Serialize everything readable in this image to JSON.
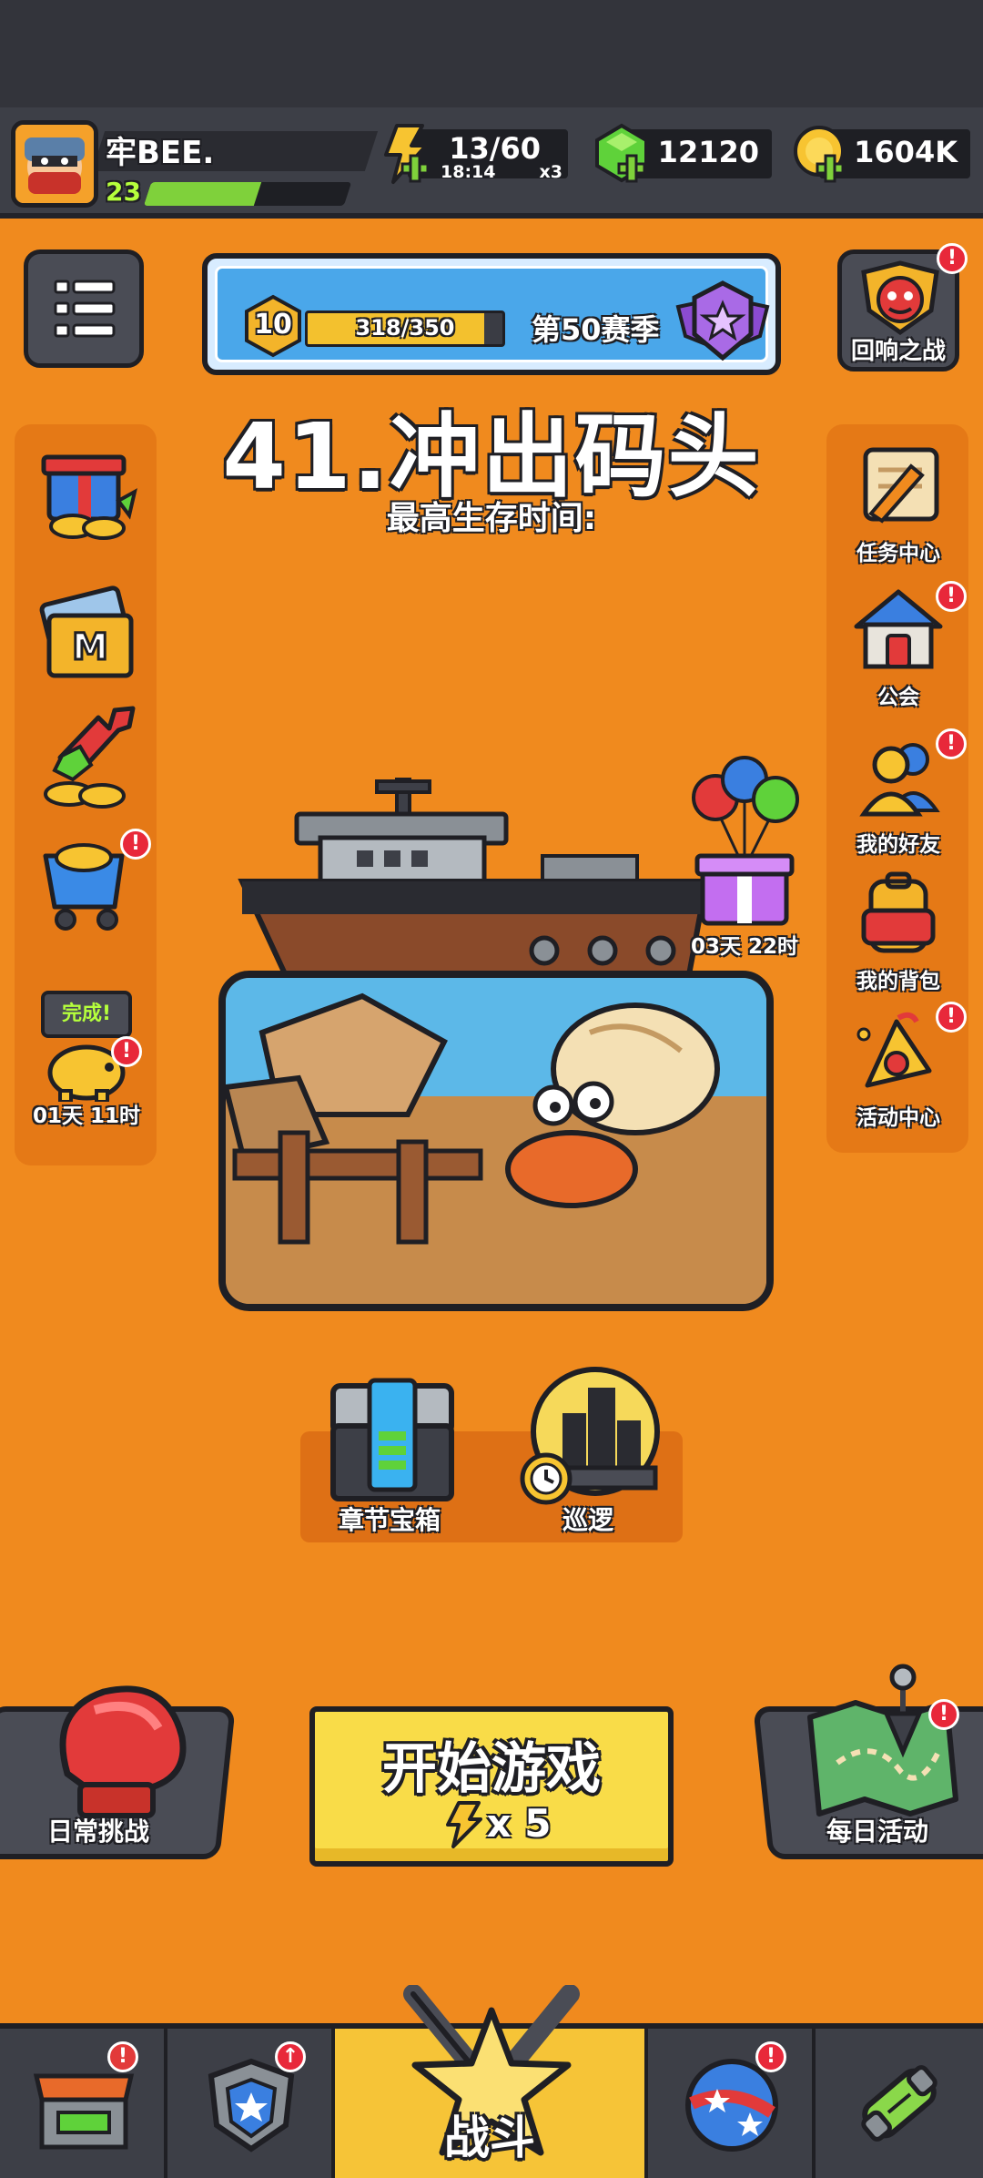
{
  "player": {
    "name": "牢BEE.",
    "level": "23",
    "xp_progress": 0.55
  },
  "resources": {
    "energy": {
      "value": "13/60",
      "timer": "18:14",
      "multiplier": "x3",
      "icon": "lightning-icon"
    },
    "gems": {
      "value": "12120",
      "icon": "gem-icon"
    },
    "gold": {
      "value": "1604K",
      "icon": "gold-coin-icon"
    }
  },
  "season": {
    "level": "10",
    "xp": "318/350",
    "xp_progress": 0.9086,
    "name": "第50赛季"
  },
  "echo_battle": {
    "label": "回响之战"
  },
  "stage": {
    "title": "41.冲出码头",
    "subtitle": "最高生存时间:"
  },
  "left_sidebar": {
    "piggy_bubble": "完成!",
    "piggy_timer": "01天 11时"
  },
  "right_sidebar": {
    "items": [
      {
        "label": "任务中心"
      },
      {
        "label": "公会"
      },
      {
        "label": "我的好友"
      },
      {
        "label": "我的背包"
      },
      {
        "label": "活动中心"
      }
    ]
  },
  "gift_timer": "03天 22时",
  "chapter": {
    "chest_label": "章节宝箱",
    "patrol_label": "巡逻"
  },
  "bottom": {
    "daily_challenge": "日常挑战",
    "start_game": "开始游戏",
    "start_cost": "x 5",
    "daily_activity": "每日活动"
  },
  "nav": {
    "battle_label": "战斗"
  },
  "badge_mark": "!",
  "colors": {
    "background": "#f08a1e",
    "accent_yellow": "#f9dc48",
    "badge_red": "#e8283a",
    "panel_dark": "#3d3f47"
  }
}
